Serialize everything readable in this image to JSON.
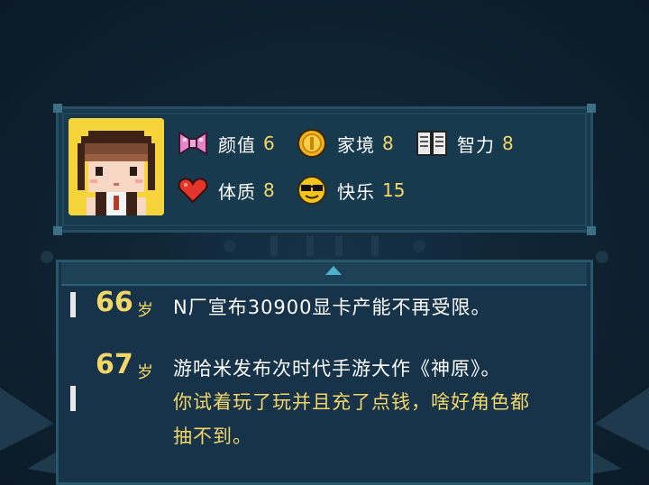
{
  "stats": [
    {
      "label": "颜值",
      "value": "6",
      "icon": "ribbon-icon"
    },
    {
      "label": "家境",
      "value": "8",
      "icon": "gold-coin-icon"
    },
    {
      "label": "智力",
      "value": "8",
      "icon": "book-icon"
    },
    {
      "label": "体质",
      "value": "8",
      "icon": "heart-icon"
    },
    {
      "label": "快乐",
      "value": "15",
      "icon": "sunglasses-smiley-icon"
    }
  ],
  "log": [
    {
      "age": "66",
      "unit": "岁",
      "lines": [
        "N厂宣布30900显卡产能不再受限。"
      ]
    },
    {
      "age": "67",
      "unit": "岁",
      "lines": [
        "游哈米发布次时代手游大作《神原》。",
        "你试着玩了玩并且充了点钱，啥好角色都",
        "抽不到。"
      ]
    }
  ],
  "colors": {
    "accent": "#f3d668",
    "panel": "#173a4e",
    "background": "#0f2434"
  }
}
